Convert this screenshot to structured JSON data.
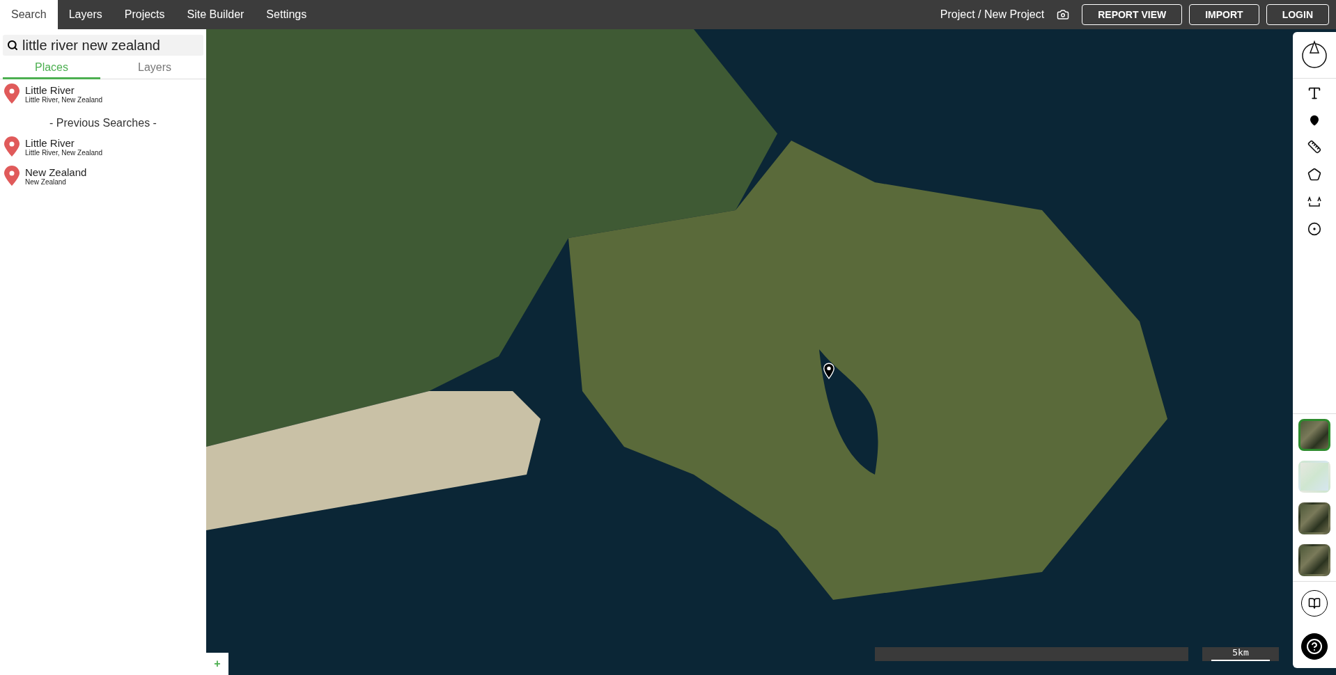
{
  "nav": {
    "tabs": [
      {
        "label": "Search",
        "selected": true
      },
      {
        "label": "Layers",
        "selected": false
      },
      {
        "label": "Projects",
        "selected": false
      },
      {
        "label": "Site Builder",
        "selected": false
      },
      {
        "label": "Settings",
        "selected": false
      }
    ],
    "project_path": "Project / New Project",
    "buttons": [
      "REPORT VIEW",
      "IMPORT",
      "LOGIN"
    ]
  },
  "search": {
    "value": "little river new zealand",
    "tabs": [
      {
        "label": "Places",
        "selected": true
      },
      {
        "label": "Layers",
        "selected": false
      }
    ],
    "results": [
      {
        "title": "Little River",
        "subtitle": "Little River, New Zealand"
      }
    ],
    "previous_heading": "- Previous Searches -",
    "previous": [
      {
        "title": "Little River",
        "subtitle": "Little River, New Zealand"
      },
      {
        "title": "New Zealand",
        "subtitle": "New Zealand"
      }
    ],
    "add_button": "+"
  },
  "basemaps": [
    {
      "kind": "satellite",
      "selected": true
    },
    {
      "kind": "street",
      "selected": false
    },
    {
      "kind": "satellite",
      "selected": false
    },
    {
      "kind": "satellite",
      "selected": false
    }
  ],
  "scale": {
    "label": "5km"
  }
}
